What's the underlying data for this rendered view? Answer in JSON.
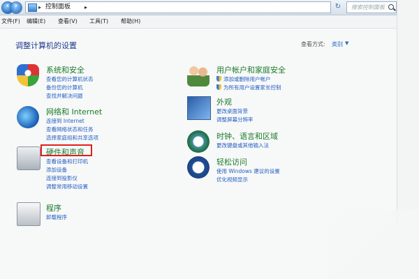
{
  "window": {
    "path": "控制面板",
    "search_placeholder": "搜索控制面板"
  },
  "menu": [
    "文件(F)",
    "编辑(E)",
    "查看(V)",
    "工具(T)",
    "帮助(H)"
  ],
  "heading": "调整计算机的设置",
  "view_by": {
    "label": "查看方式:",
    "value": "类别"
  },
  "categories": [
    {
      "title": "系统和安全",
      "links": [
        "查看您的计算机状态",
        "备份您的计算机",
        "查找并解决问题"
      ]
    },
    {
      "title": "网络和 Internet",
      "links": [
        "连接到 Internet",
        "查看网络状态和任务",
        "选择家庭组和共享选项"
      ]
    },
    {
      "title": "硬件和声音",
      "links": [
        "查看设备和打印机",
        "添加设备",
        "连接到投影仪",
        "调整常用移动设置"
      ]
    },
    {
      "title": "程序",
      "links": [
        "卸载程序"
      ]
    },
    {
      "title": "用户帐户和家庭安全",
      "links": [
        "添加或删除用户帐户",
        "为所有用户设置家长控制"
      ]
    },
    {
      "title": "外观",
      "links": [
        "更改桌面背景",
        "调整屏幕分辨率"
      ]
    },
    {
      "title": "时钟、语言和区域",
      "links": [
        "更改键盘或其他输入法"
      ]
    },
    {
      "title": "轻松访问",
      "links": [
        "使用 Windows 建议的设置",
        "优化视频显示"
      ]
    }
  ],
  "colors": {
    "highlight": "#e0201c",
    "link": "#2460c4",
    "category_title": "#1a7a2a"
  }
}
